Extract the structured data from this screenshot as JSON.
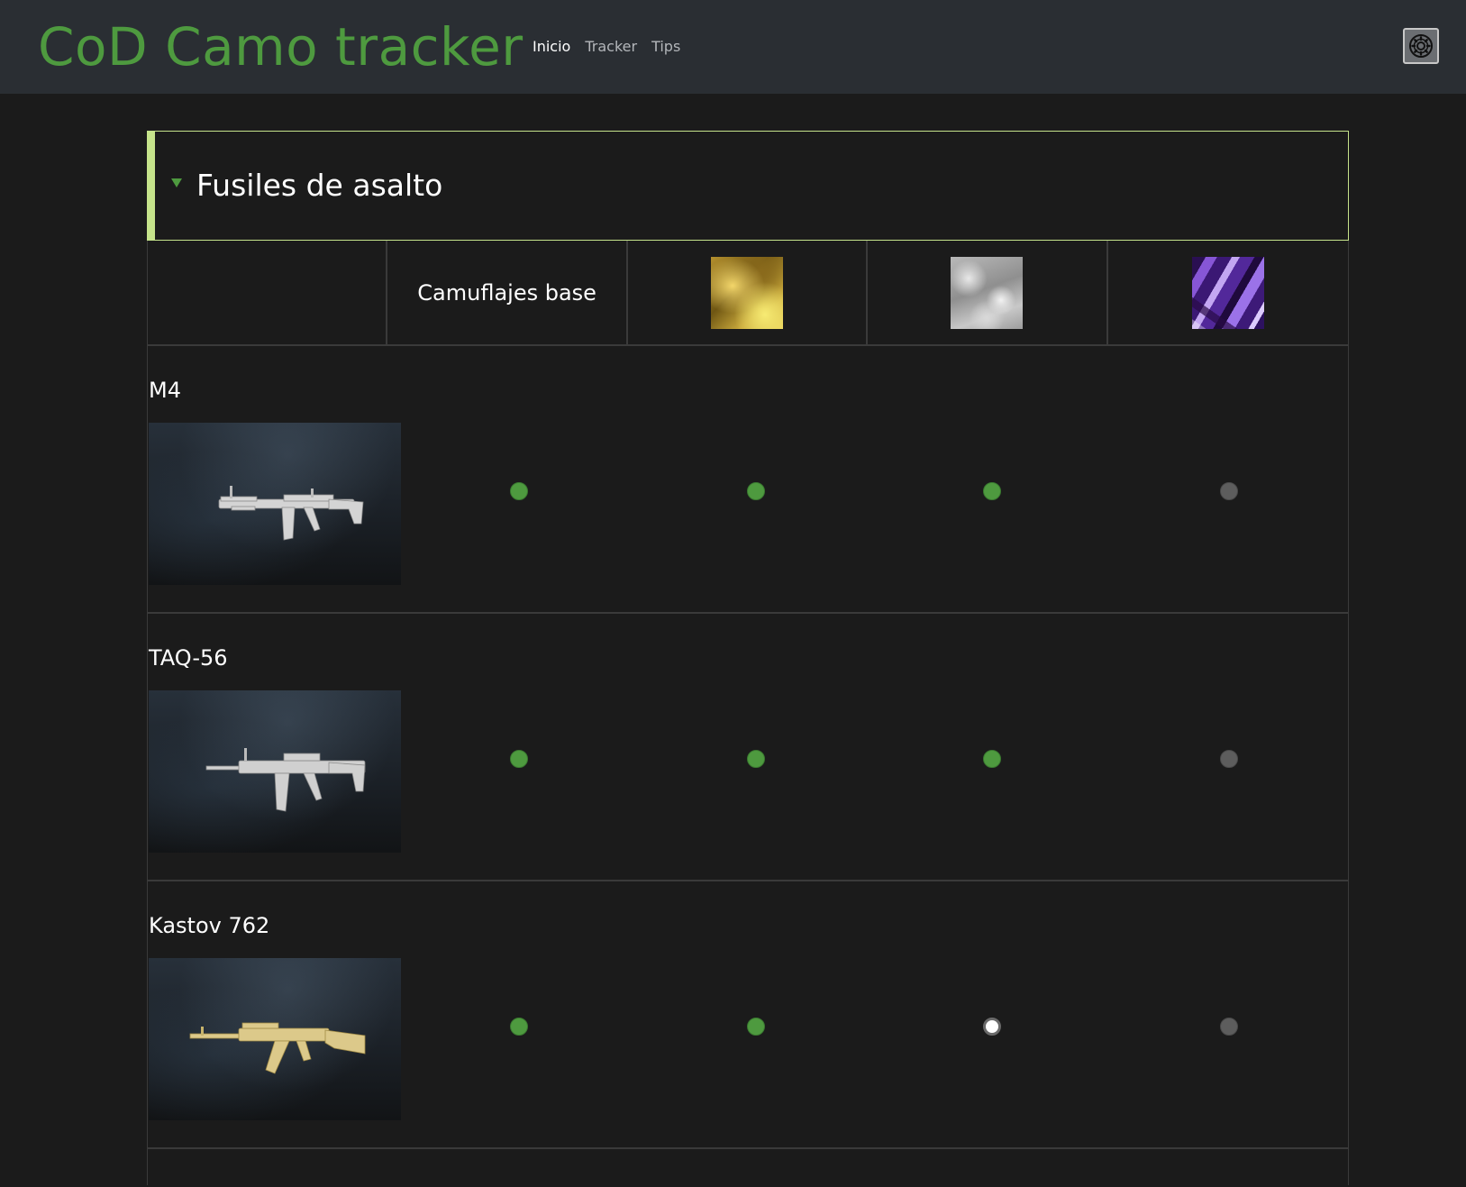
{
  "header": {
    "brand": "CoD Camo tracker",
    "nav": [
      {
        "label": "Inicio",
        "active": true
      },
      {
        "label": "Tracker",
        "active": false
      },
      {
        "label": "Tips",
        "active": false
      }
    ],
    "settings_icon": "gear-icon"
  },
  "section": {
    "title": "Fusiles de asalto",
    "caret_icon": "caret-down-icon",
    "columns": {
      "base_label": "Camuflajes base",
      "camos": [
        "gold-camo",
        "platinum-camo",
        "polyatomic-camo"
      ]
    },
    "weapons": [
      {
        "name": "M4",
        "image": "m4-rifle-image",
        "status": [
          "done",
          "done",
          "done",
          "todo"
        ]
      },
      {
        "name": "TAQ-56",
        "image": "taq56-rifle-image",
        "status": [
          "done",
          "done",
          "done",
          "todo"
        ]
      },
      {
        "name": "Kastov 762",
        "image": "kastov762-rifle-image",
        "status": [
          "done",
          "done",
          "current",
          "todo"
        ]
      }
    ]
  },
  "colors": {
    "brand": "#4e9a3f",
    "header_bg": "#2a2e33",
    "page_bg": "#1b1b1b",
    "section_accent": "#c6e48b",
    "done": "#4e9a3f",
    "todo": "#5d5d5d",
    "current": "#ffffff"
  }
}
